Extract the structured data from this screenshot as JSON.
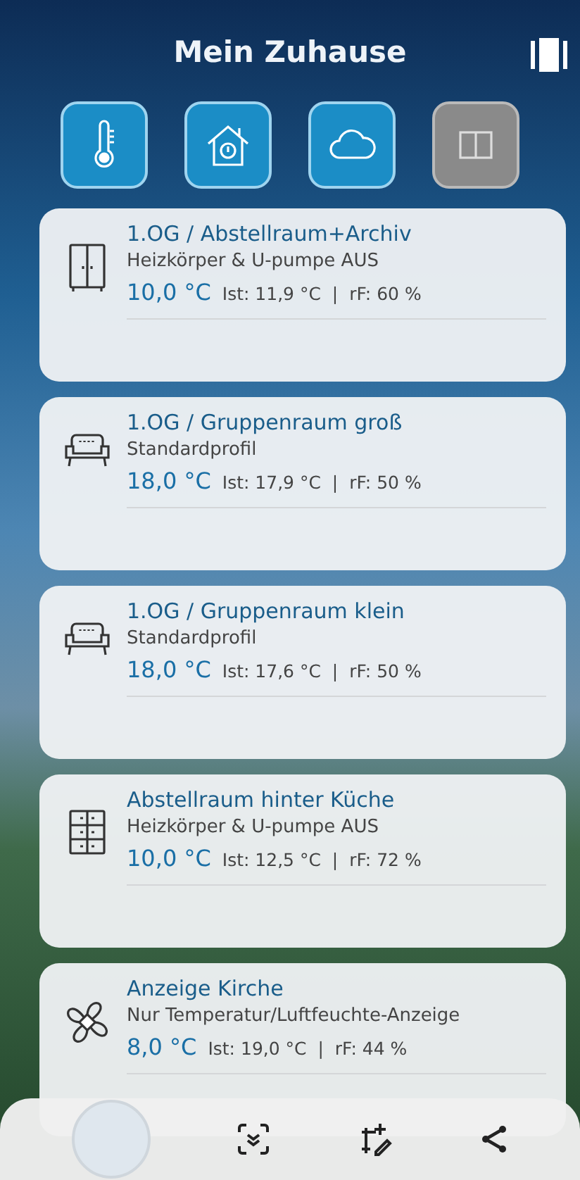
{
  "header": {
    "title": "Mein Zuhause"
  },
  "modes": [
    {
      "kind": "thermometer",
      "selected": true
    },
    {
      "kind": "house",
      "selected": true
    },
    {
      "kind": "cloud",
      "selected": true
    },
    {
      "kind": "window",
      "selected": false
    }
  ],
  "rooms": [
    {
      "kind": "cabinet",
      "name": "1.OG / Abstellraum+Archiv",
      "profile": "Heizkörper & U-pumpe AUS",
      "setpoint": "10,0 °C",
      "reading": "Ist: 11,9 °C  |  rF: 60 %"
    },
    {
      "kind": "sofa",
      "name": "1.OG / Gruppenraum groß",
      "profile": "Standardprofil",
      "setpoint": "18,0 °C",
      "reading": "Ist: 17,9 °C  |  rF: 50 %"
    },
    {
      "kind": "sofa",
      "name": "1.OG / Gruppenraum klein",
      "profile": "Standardprofil",
      "setpoint": "18,0 °C",
      "reading": "Ist: 17,6 °C  |  rF: 50 %"
    },
    {
      "kind": "drawers",
      "name": "Abstellraum hinter Küche",
      "profile": "Heizkörper & U-pumpe AUS",
      "setpoint": "10,0 °C",
      "reading": "Ist: 12,5 °C  |  rF: 72 %"
    },
    {
      "kind": "fan",
      "name": "Anzeige Kirche",
      "profile": "Nur Temperatur/Luftfeuchte-Anzeige",
      "setpoint": "8,0 °C",
      "reading": "Ist: 19,0 °C  |  rF: 44 %"
    }
  ]
}
